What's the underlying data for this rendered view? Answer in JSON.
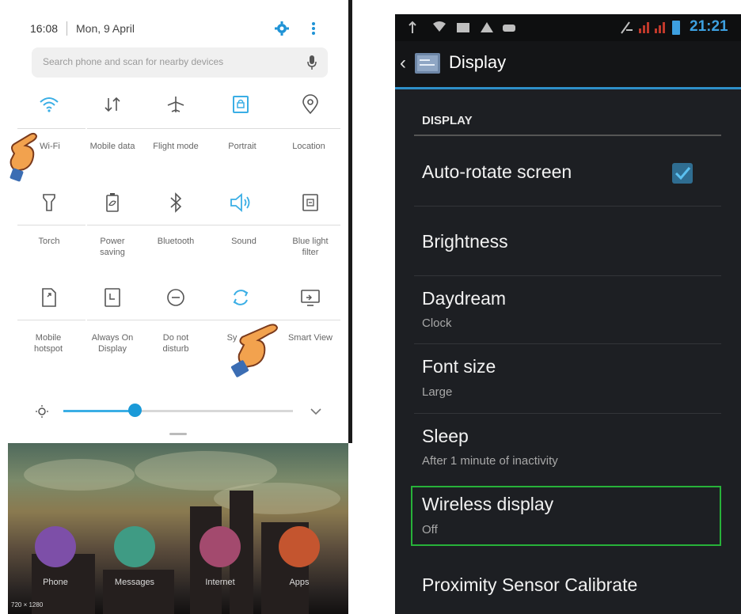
{
  "left_panel": {
    "status_bar": {
      "time": "16:08",
      "date": "Mon, 9 April"
    },
    "search": {
      "placeholder": "Search phone and scan for nearby devices"
    },
    "tiles": [
      {
        "label": "Wi-Fi",
        "icon": "wifi-icon",
        "active": true
      },
      {
        "label": "Mobile data",
        "icon": "mobile-data-icon",
        "active": false
      },
      {
        "label": "Flight mode",
        "icon": "airplane-icon",
        "active": false
      },
      {
        "label": "Portrait",
        "icon": "portrait-lock-icon",
        "active": true
      },
      {
        "label": "Location",
        "icon": "location-icon",
        "active": false
      },
      {
        "label": "Torch",
        "icon": "torch-icon",
        "active": false
      },
      {
        "label": "Power saving",
        "icon": "power-saving-icon",
        "active": false
      },
      {
        "label": "Bluetooth",
        "icon": "bluetooth-icon",
        "active": false
      },
      {
        "label": "Sound",
        "icon": "sound-icon",
        "active": true
      },
      {
        "label": "Blue light filter",
        "icon": "blue-light-filter-icon",
        "active": false
      },
      {
        "label": "Mobile hotspot",
        "icon": "hotspot-icon",
        "active": false
      },
      {
        "label": "Always On Display",
        "icon": "always-on-display-icon",
        "active": false
      },
      {
        "label": "Do not disturb",
        "icon": "do-not-disturb-icon",
        "active": false
      },
      {
        "label": "Sy",
        "icon": "sync-icon",
        "active": true
      },
      {
        "label": "Smart View",
        "icon": "smart-view-icon",
        "active": false
      }
    ],
    "brightness": {
      "level": 0.31
    },
    "home_apps": [
      {
        "label": "Phone",
        "color": "#7d4fa8"
      },
      {
        "label": "Messages",
        "color": "#3f9b84"
      },
      {
        "label": "Internet",
        "color": "#a34a6e"
      },
      {
        "label": "Apps",
        "color": "#c4552f"
      }
    ],
    "resolution_text": "720 × 1280"
  },
  "right_panel": {
    "status_bar": {
      "time": "21:21"
    },
    "header": {
      "title": "Display",
      "back": "‹"
    },
    "section_title": "DISPLAY",
    "items": [
      {
        "title": "Auto-rotate screen",
        "subtitle": ""
      },
      {
        "title": "Brightness",
        "subtitle": ""
      },
      {
        "title": "Daydream",
        "subtitle": "Clock"
      },
      {
        "title": "Font size",
        "subtitle": "Large"
      },
      {
        "title": "Sleep",
        "subtitle": "After 1 minute of inactivity"
      },
      {
        "title": "Wireless display",
        "subtitle": "Off"
      },
      {
        "title": "Proximity Sensor Calibrate",
        "subtitle": ""
      }
    ],
    "auto_rotate_checked": true
  },
  "colors": {
    "accent_blue": "#3aaee5",
    "highlight_green": "#27b239"
  }
}
